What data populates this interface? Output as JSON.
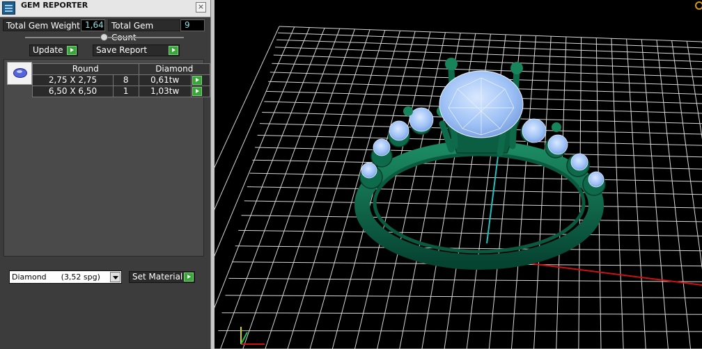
{
  "panel": {
    "title": "GEM REPORTER",
    "close_label": "×",
    "stats": {
      "total_weight_label": "Total Gem Weight",
      "total_weight_value": "1,64",
      "total_count_label": "Total Gem Count",
      "total_count_value": "9"
    },
    "buttons": {
      "update_label": "Update",
      "save_report_label": "Save Report",
      "set_material_label": "Set Material"
    },
    "table": {
      "header_shape": "Round",
      "header_material": "Diamond",
      "rows": [
        {
          "size": "2,75 X 2,75",
          "count": "8",
          "weight": "0,61tw"
        },
        {
          "size": "6,50 X 6,50",
          "count": "1",
          "weight": "1,03tw"
        }
      ]
    },
    "material_select": {
      "selected": "Diamond      (3,52 spg)"
    }
  },
  "viewport": {
    "background": "#000000",
    "grid_color": "#d8d8d8",
    "metal_color": "#0d6a4a",
    "gem_color": "#9cc0f5",
    "axis_y_color": "#25c0c0",
    "axis_x_color": "#d01010"
  }
}
